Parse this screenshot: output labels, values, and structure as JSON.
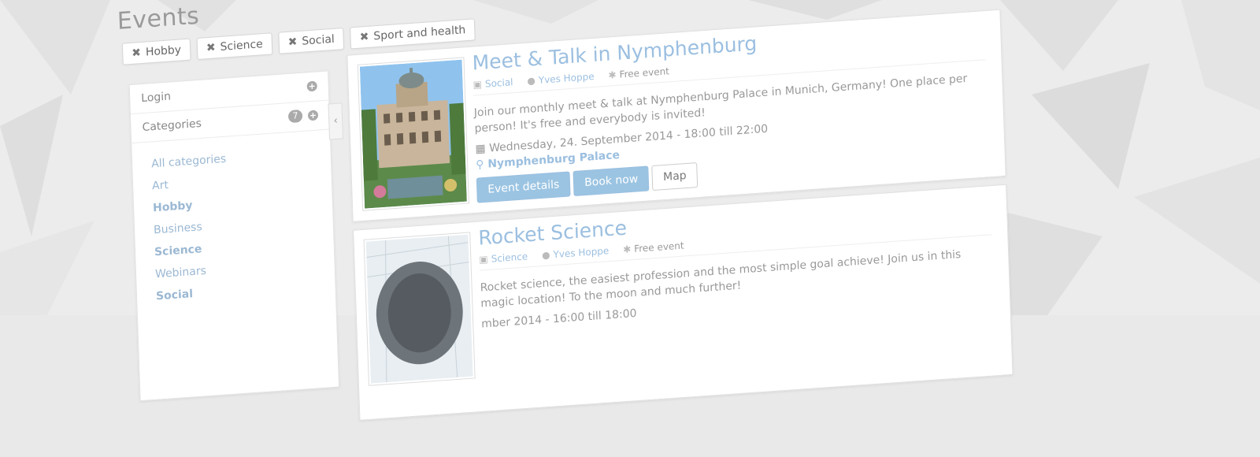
{
  "page": {
    "title": "Events"
  },
  "filters": [
    {
      "label": "Hobby"
    },
    {
      "label": "Science"
    },
    {
      "label": "Social"
    },
    {
      "label": "Sport and health"
    }
  ],
  "sidebar": {
    "login_label": "Login",
    "categories_label": "Categories",
    "categories_count": "7",
    "categories": [
      {
        "label": "All categories",
        "bold": false
      },
      {
        "label": "Art",
        "bold": false
      },
      {
        "label": "Hobby",
        "bold": true
      },
      {
        "label": "Business",
        "bold": false
      },
      {
        "label": "Science",
        "bold": true
      },
      {
        "label": "Webinars",
        "bold": false
      },
      {
        "label": "Social",
        "bold": true
      }
    ]
  },
  "events": [
    {
      "title": "Meet & Talk in Nymphenburg",
      "category": "Social",
      "organizer": "Yves Hoppe",
      "price": "Free event",
      "description": "Join our monthly meet & talk at Nymphenburg Palace in Munich, Germany! One place per person! It's free and everybody is invited!",
      "datetime": "Wednesday, 24. September 2014 - 18:00 till 22:00",
      "location": "Nymphenburg Palace",
      "btn_details": "Event details",
      "btn_book": "Book now",
      "btn_map": "Map"
    },
    {
      "title": "Rocket Science",
      "category": "Science",
      "organizer": "Yves Hoppe",
      "price": "Free event",
      "description": "Rocket science, the easiest profession and the most simple goal achieve! Join us in this magic location! To the moon and much further!",
      "datetime": "mber 2014 - 16:00 till 18:00"
    }
  ]
}
